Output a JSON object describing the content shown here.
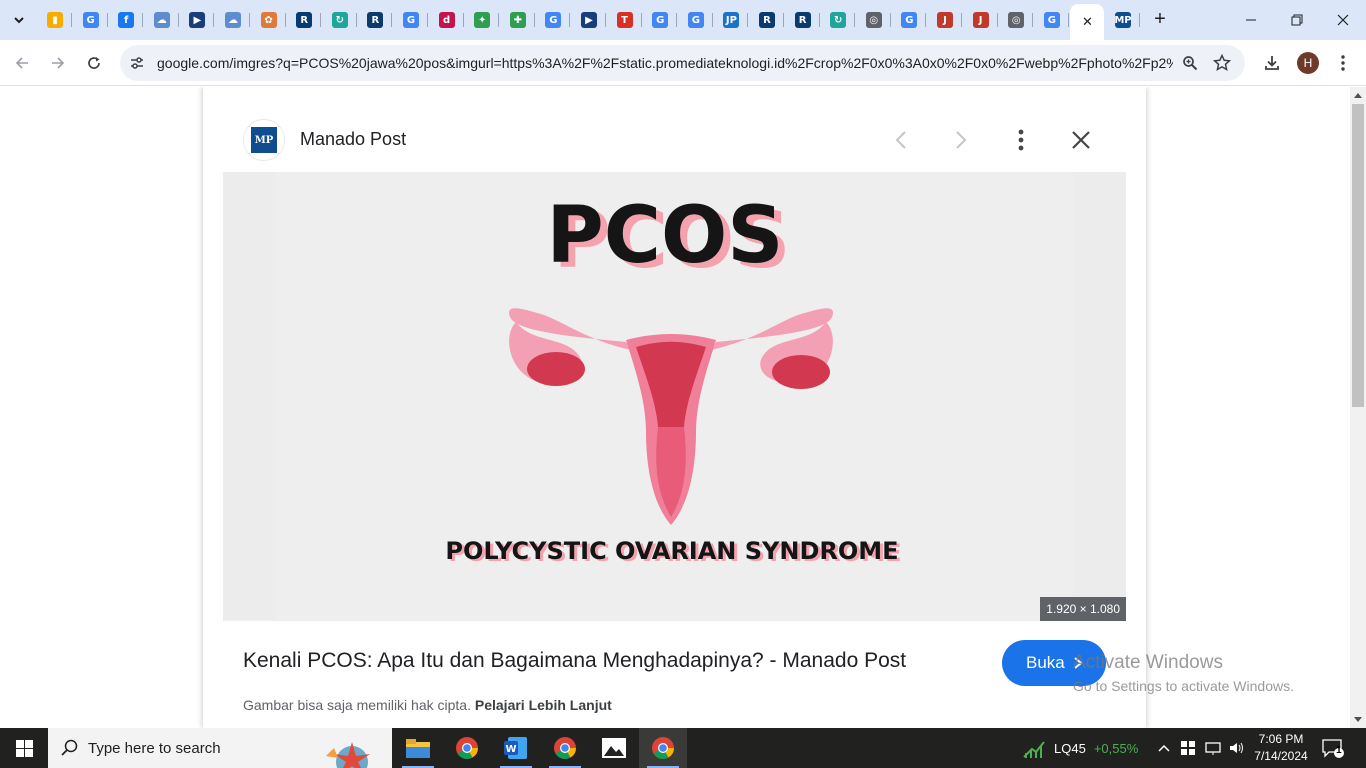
{
  "browser": {
    "tabs": [
      {
        "icon": "analytics-icon",
        "color": "#f9ab00",
        "glyph": "▮"
      },
      {
        "icon": "google-icon",
        "color": "#4285f4",
        "glyph": "G"
      },
      {
        "icon": "facebook-icon",
        "color": "#1877f2",
        "glyph": "f"
      },
      {
        "icon": "cloud-icon",
        "color": "#5f8ccf",
        "glyph": "☁"
      },
      {
        "icon": "play-icon",
        "color": "#1a3d7c",
        "glyph": "▶"
      },
      {
        "icon": "cloud-icon",
        "color": "#5f8ccf",
        "glyph": "☁"
      },
      {
        "icon": "flower-icon",
        "color": "#e07a3a",
        "glyph": "✿"
      },
      {
        "icon": "ro-icon",
        "color": "#0b3a6e",
        "glyph": "R"
      },
      {
        "icon": "circle-arrow-icon",
        "color": "#1fa59b",
        "glyph": "↻"
      },
      {
        "icon": "ro-icon",
        "color": "#0b3a6e",
        "glyph": "R"
      },
      {
        "icon": "google-icon",
        "color": "#4285f4",
        "glyph": "G"
      },
      {
        "icon": "d-icon",
        "color": "#c3144e",
        "glyph": "d"
      },
      {
        "icon": "sparkle-icon",
        "color": "#2e9e4f",
        "glyph": "✦"
      },
      {
        "icon": "cross-icon",
        "color": "#2e9e4f",
        "glyph": "✚"
      },
      {
        "icon": "google-icon",
        "color": "#4285f4",
        "glyph": "G"
      },
      {
        "icon": "play-icon",
        "color": "#1a3d7c",
        "glyph": "▶"
      },
      {
        "icon": "t-icon",
        "color": "#d93025",
        "glyph": "T"
      },
      {
        "icon": "google-icon",
        "color": "#4285f4",
        "glyph": "G"
      },
      {
        "icon": "google-icon",
        "color": "#4285f4",
        "glyph": "G"
      },
      {
        "icon": "jp-icon",
        "color": "#1a73c8",
        "glyph": "JP"
      },
      {
        "icon": "ro-icon",
        "color": "#0b3a6e",
        "glyph": "R"
      },
      {
        "icon": "ro-icon",
        "color": "#0b3a6e",
        "glyph": "R"
      },
      {
        "icon": "circle-arrow-icon",
        "color": "#1fa59b",
        "glyph": "↻"
      },
      {
        "icon": "chrome-icon",
        "color": "#5f6368",
        "glyph": "◎"
      },
      {
        "icon": "google-icon",
        "color": "#4285f4",
        "glyph": "G"
      },
      {
        "icon": "jdih-icon",
        "color": "#c0392b",
        "glyph": "J"
      },
      {
        "icon": "jdih-icon",
        "color": "#c0392b",
        "glyph": "J"
      },
      {
        "icon": "chrome-icon",
        "color": "#5f6368",
        "glyph": "◎"
      },
      {
        "icon": "google-icon",
        "color": "#4285f4",
        "glyph": "G"
      },
      {
        "icon": "close-icon",
        "color": "#1f1f1f",
        "glyph": "✕",
        "active": true
      },
      {
        "icon": "mp-icon",
        "color": "#0e4d8f",
        "glyph": "MP"
      }
    ],
    "new_tab_label": "+",
    "url": "google.com/imgres?q=PCOS%20jawa%20pos&imgurl=https%3A%2F%2Fstatic.promediateknologi.id%2Fcrop%2F0x0%3A0x0%2F0x0%2Fwebp%2Fphoto%2Fp2%2...",
    "profile_initial": "H"
  },
  "viewer": {
    "source_logo_text": "MP",
    "source_name": "Manado Post",
    "image_size": "1.920 × 1.080",
    "image_heading": "PCOS",
    "image_caption": "POLYCYSTIC OVARIAN SYNDROME",
    "title": "Kenali PCOS: Apa Itu dan Bagaimana Menghadapinya? - Manado Post",
    "open_label": "Buka",
    "copyright_text": "Gambar bisa saja memiliki hak cipta.",
    "learn_more": "Pelajari Lebih Lanjut"
  },
  "watermark": {
    "line1": "Activate Windows",
    "line2": "Go to Settings to activate Windows."
  },
  "taskbar": {
    "search_placeholder": "Type here to search",
    "stock_name": "LQ45",
    "stock_change": "+0,55%",
    "time": "7:06 PM",
    "date": "7/14/2024",
    "notification_count": "1"
  }
}
